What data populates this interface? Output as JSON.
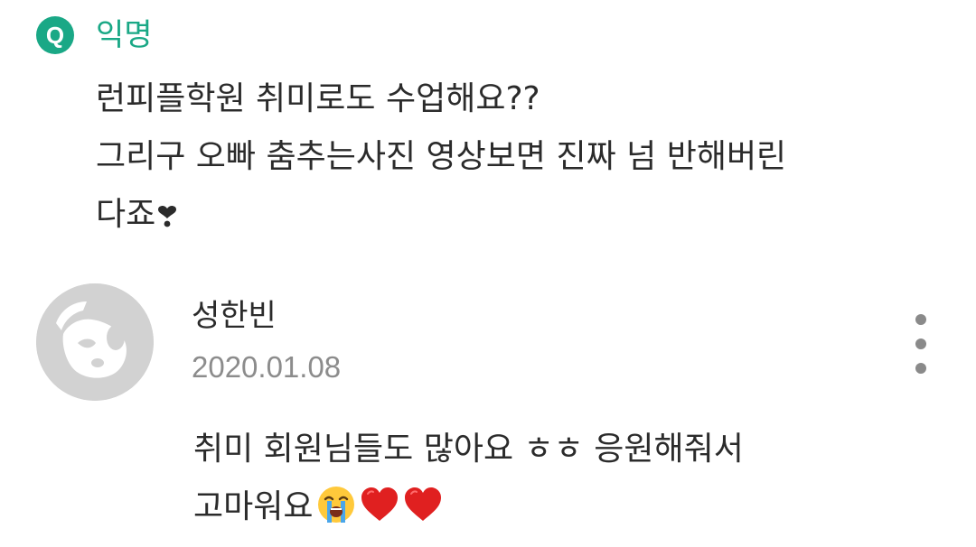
{
  "question": {
    "badge_letter": "Q",
    "author": "익명",
    "accent_color": "#1aa886",
    "lines": [
      "런피플학원 취미로도 수업해요??",
      "그리구 오빠 춤추는사진 영상보면 진짜 넘  반해버린",
      "다죠"
    ],
    "trailing_icon": "heart-exclamation-icon"
  },
  "reply": {
    "avatar_icon": "default-profile-icon",
    "author": "성한빈",
    "date": "2020.01.08",
    "more_icon": "more-vertical-icon",
    "lines": [
      "취미 회원님들도 많아요 ㅎㅎ 응원해줘서",
      "고마워요"
    ],
    "trailing_emojis": [
      "loudly-crying-face-icon",
      "red-heart-icon",
      "red-heart-icon"
    ]
  }
}
